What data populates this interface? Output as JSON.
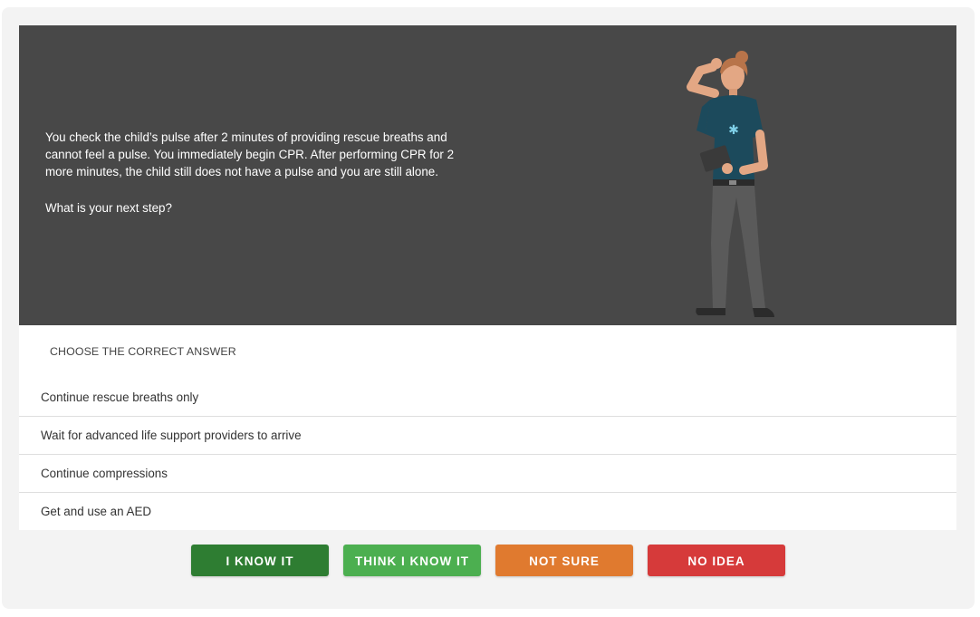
{
  "scenario": {
    "text": "You check the child’s pulse after 2 minutes of providing rescue breaths and cannot feel a pulse. You immediately begin CPR. After performing CPR for 2 more minutes, the child still does not have a pulse and you are still alone.",
    "question": "What is your next step?",
    "illustration": "rescuer-thinking-with-tablet"
  },
  "answers": {
    "label": "CHOOSE THE CORRECT ANSWER",
    "options": [
      "Continue rescue breaths only",
      "Wait for advanced life support providers to arrive",
      "Continue compressions",
      "Get and use an AED"
    ]
  },
  "confidence_buttons": [
    {
      "label": "I KNOW IT",
      "color": "#2e7d32"
    },
    {
      "label": "THINK I KNOW IT",
      "color": "#4caf50"
    },
    {
      "label": "NOT SURE",
      "color": "#e07a2f"
    },
    {
      "label": "NO IDEA",
      "color": "#d63a3a"
    }
  ],
  "colors": {
    "scenario_bg": "#484848",
    "frame_bg": "#f3f3f3",
    "badge_star": "#7fd0e8"
  }
}
